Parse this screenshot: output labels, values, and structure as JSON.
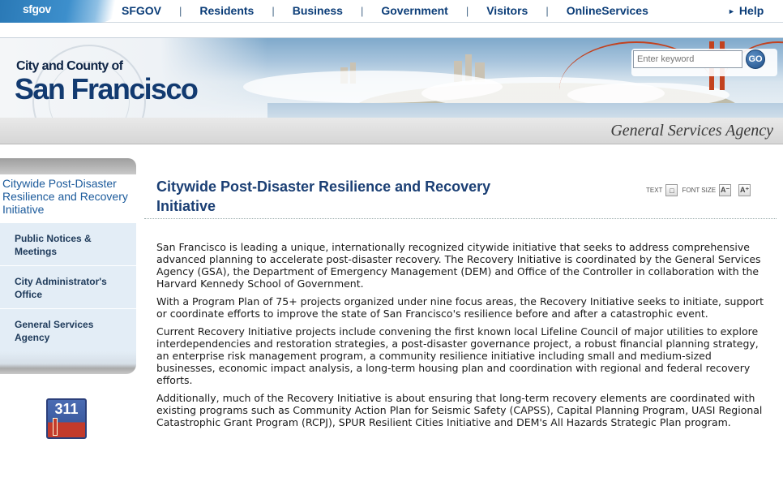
{
  "top_nav": {
    "logo": "sfgov",
    "items": [
      "SFGOV",
      "Residents",
      "Business",
      "Government",
      "Visitors",
      "OnlineServices"
    ],
    "help": "Help"
  },
  "banner": {
    "title_small": "City and County of",
    "title_big": "San Francisco",
    "search_placeholder": "Enter keyword",
    "go": "GO"
  },
  "agency": "General Services Agency",
  "sidebar": {
    "heading": "Citywide Post-Disaster Resilience and Recovery Initiative",
    "items": [
      {
        "label": "Public Notices & Meetings"
      },
      {
        "label": "City Administrator's Office"
      },
      {
        "label": "General Services Agency"
      }
    ],
    "badge": "311"
  },
  "main": {
    "title": "Citywide Post-Disaster Resilience and Recovery Initiative",
    "text_label": "TEXT",
    "font_size_label": "FONT SIZE",
    "paragraphs": [
      "San Francisco is leading a unique, internationally recognized citywide initiative that seeks to address comprehensive advanced planning to accelerate post-disaster recovery. The Recovery Initiative is coordinated by the General Services Agency (GSA), the Department of Emergency Management (DEM) and Office of the Controller in collaboration with the Harvard Kennedy School of Government.",
      "With a Program Plan of 75+ projects organized under nine focus areas, the Recovery Initiative seeks to initiate, support or coordinate efforts to improve the state of San Francisco's resilience before and after a catastrophic event.",
      "Current Recovery Initiative projects include convening the first known local Lifeline Council of major utilities to explore interdependencies and restoration strategies, a post-disaster governance project, a robust financial planning strategy, an enterprise risk management program, a community resilience initiative including small and medium-sized businesses, economic impact analysis, a long-term housing plan and coordination with regional and federal recovery efforts.",
      "Additionally, much of the Recovery Initiative is about ensuring that long-term recovery elements are coordinated with existing programs such as Community Action Plan for Seismic Safety (CAPSS), Capital Planning Program, UASI Regional Catastrophic Grant Program (RCPJ), SPUR Resilient Cities Initiative and DEM's All Hazards Strategic Plan program."
    ]
  }
}
